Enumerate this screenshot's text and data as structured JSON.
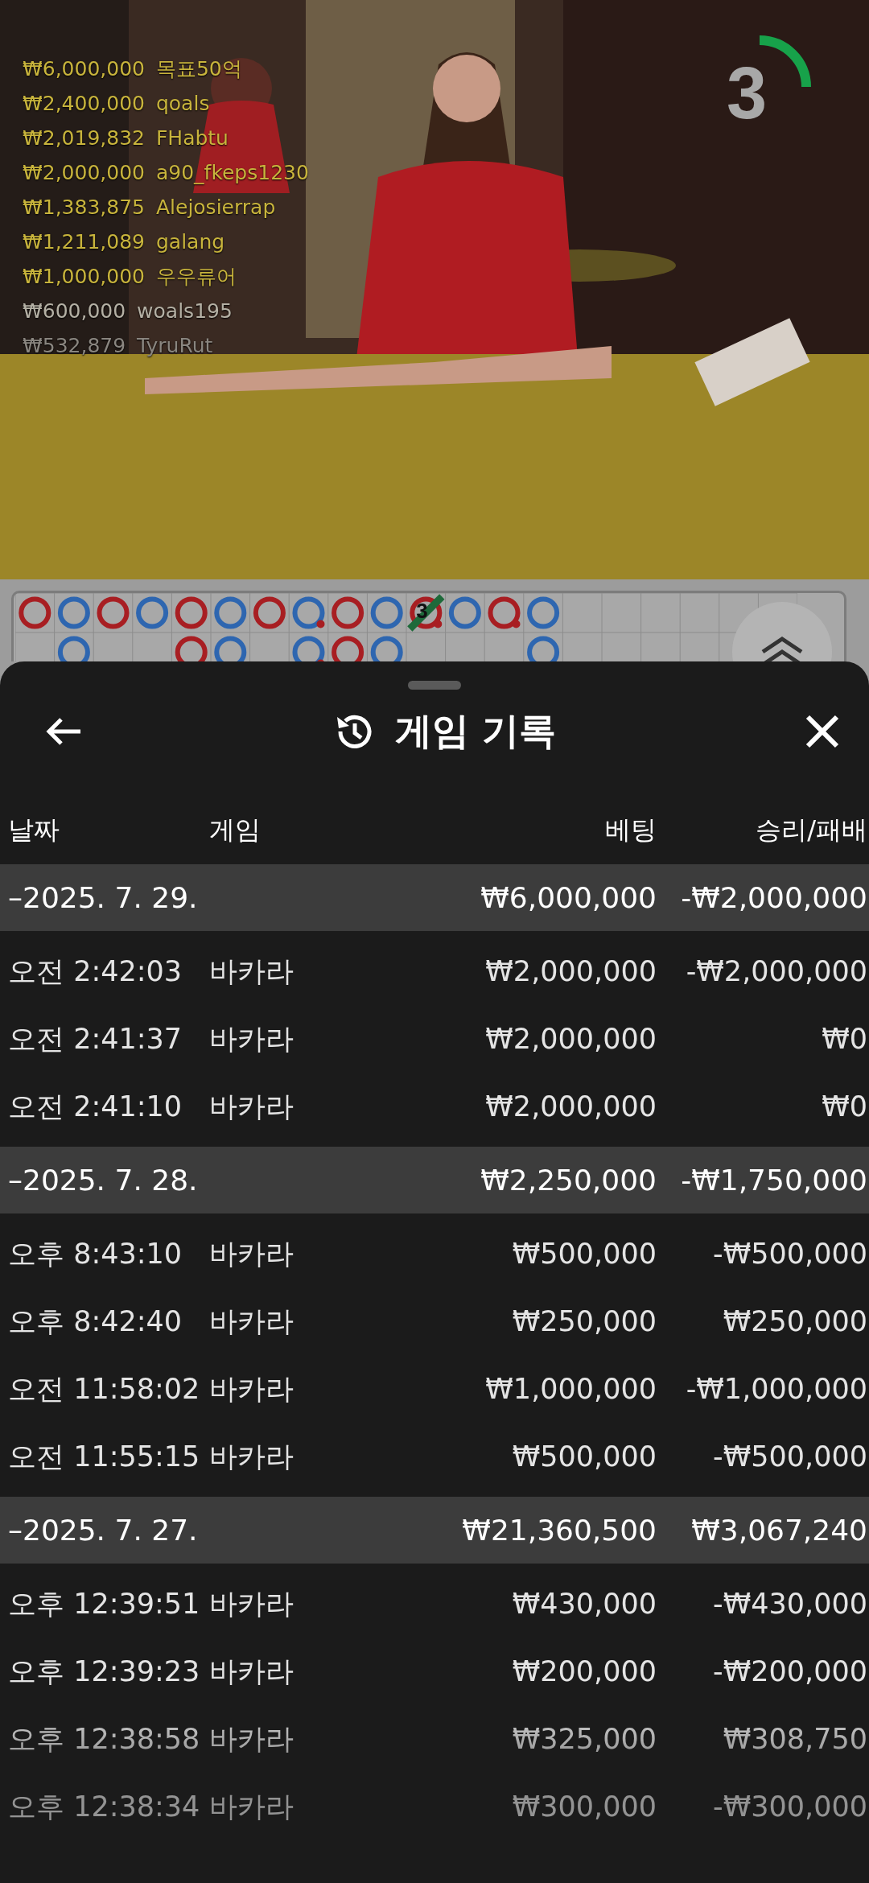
{
  "video": {
    "countdown": {
      "text": "3"
    },
    "leaderboard": [
      {
        "amount": "₩6,000,000",
        "name": "목표50억",
        "color": "#c8b43c"
      },
      {
        "amount": "₩2,400,000",
        "name": "qoals",
        "color": "#c8b43c"
      },
      {
        "amount": "₩2,019,832",
        "name": "FHabtu",
        "color": "#c8b43c"
      },
      {
        "amount": "₩2,000,000",
        "name": "a90_fkeps1230",
        "color": "#c8b43c"
      },
      {
        "amount": "₩1,383,875",
        "name": "Alejosierrap",
        "color": "#c8b43c"
      },
      {
        "amount": "₩1,211,089",
        "name": "galang",
        "color": "#c8b43c"
      },
      {
        "amount": "₩1,000,000",
        "name": "우우류어",
        "color": "#c8b43c"
      },
      {
        "amount": "₩600,000",
        "name": "woals195",
        "color": "#b4b0a4"
      },
      {
        "amount": "₩532,879",
        "name": "TyruRut",
        "color": "#8a8680"
      }
    ]
  },
  "roadmap": {
    "columns": [
      [
        {
          "kind": "banker"
        },
        {
          "kind": "empty"
        }
      ],
      [
        {
          "kind": "player"
        },
        {
          "kind": "player"
        }
      ],
      [
        {
          "kind": "banker"
        },
        {
          "kind": "empty"
        }
      ],
      [
        {
          "kind": "player"
        },
        {
          "kind": "empty"
        }
      ],
      [
        {
          "kind": "banker"
        },
        {
          "kind": "banker"
        }
      ],
      [
        {
          "kind": "player"
        },
        {
          "kind": "player"
        }
      ],
      [
        {
          "kind": "banker"
        },
        {
          "kind": "empty"
        }
      ],
      [
        {
          "kind": "player",
          "pair": true
        },
        {
          "kind": "player",
          "pair": true
        }
      ],
      [
        {
          "kind": "banker"
        },
        {
          "kind": "banker"
        }
      ],
      [
        {
          "kind": "player"
        },
        {
          "kind": "player"
        }
      ],
      [
        {
          "kind": "banker",
          "pair": true,
          "tie_count": "3"
        },
        {
          "kind": "empty"
        }
      ],
      [
        {
          "kind": "player"
        },
        {
          "kind": "empty"
        }
      ],
      [
        {
          "kind": "banker",
          "pair": true
        },
        {
          "kind": "empty"
        }
      ],
      [
        {
          "kind": "player"
        },
        {
          "kind": "player"
        }
      ]
    ]
  },
  "sheet": {
    "title": "게임 기록",
    "columns": [
      "날짜",
      "게임",
      "베팅",
      "승리/패배"
    ],
    "groups": [
      {
        "date": "–2025. 7. 29.",
        "bet": "₩6,000,000",
        "result": "-₩2,000,000",
        "rows": [
          {
            "time": "오전 2:42:03",
            "game": "바카라",
            "bet": "₩2,000,000",
            "result": "-₩2,000,000"
          },
          {
            "time": "오전 2:41:37",
            "game": "바카라",
            "bet": "₩2,000,000",
            "result": "₩0"
          },
          {
            "time": "오전 2:41:10",
            "game": "바카라",
            "bet": "₩2,000,000",
            "result": "₩0"
          }
        ]
      },
      {
        "date": "–2025. 7. 28.",
        "bet": "₩2,250,000",
        "result": "-₩1,750,000",
        "rows": [
          {
            "time": "오후 8:43:10",
            "game": "바카라",
            "bet": "₩500,000",
            "result": "-₩500,000"
          },
          {
            "time": "오후 8:42:40",
            "game": "바카라",
            "bet": "₩250,000",
            "result": "₩250,000"
          },
          {
            "time": "오전 11:58:02",
            "game": "바카라",
            "bet": "₩1,000,000",
            "result": "-₩1,000,000"
          },
          {
            "time": "오전 11:55:15",
            "game": "바카라",
            "bet": "₩500,000",
            "result": "-₩500,000"
          }
        ]
      },
      {
        "date": "–2025. 7. 27.",
        "bet": "₩21,360,500",
        "result": "₩3,067,240",
        "rows": [
          {
            "time": "오후 12:39:51",
            "game": "바카라",
            "bet": "₩430,000",
            "result": "-₩430,000"
          },
          {
            "time": "오후 12:39:23",
            "game": "바카라",
            "bet": "₩200,000",
            "result": "-₩200,000"
          },
          {
            "time": "오후 12:38:58",
            "game": "바카라",
            "bet": "₩325,000",
            "result": "₩308,750"
          },
          {
            "time": "오후 12:38:34",
            "game": "바카라",
            "bet": "₩300,000",
            "result": "-₩300,000"
          }
        ]
      }
    ]
  }
}
